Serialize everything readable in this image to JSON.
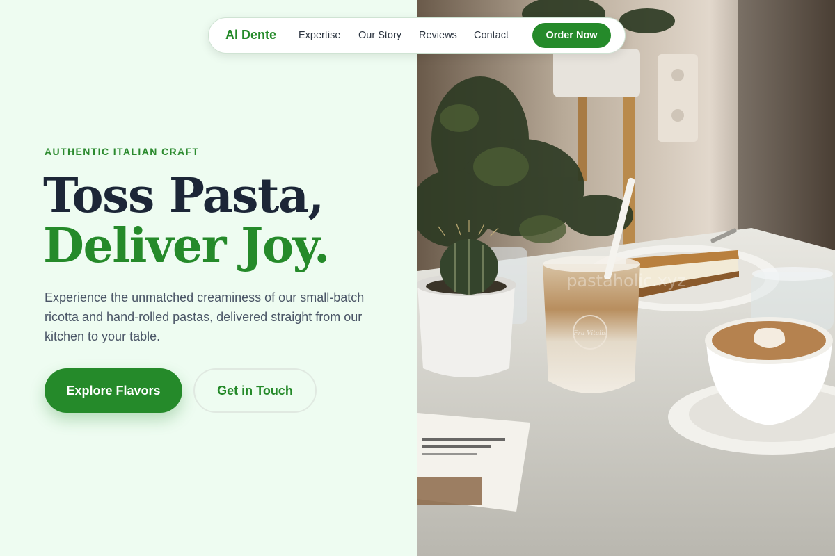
{
  "nav": {
    "brand": "Al Dente",
    "links": [
      "Expertise",
      "Our Story",
      "Reviews",
      "Contact"
    ],
    "cta": "Order Now"
  },
  "hero": {
    "eyebrow": "AUTHENTIC ITALIAN CRAFT",
    "headline_line1": "Toss Pasta,",
    "headline_line2": "Deliver Joy.",
    "lede": "Experience the unmatched creaminess of our small-batch ricotta and hand-rolled pastas, delivered straight from our kitchen to your table.",
    "primary_cta": "Explore Flavors",
    "secondary_cta": "Get in Touch"
  },
  "photo": {
    "subject": "cafe-table-photo",
    "watermark": "pastaholic.xyz",
    "cup_logo": "Fra Vitalis"
  },
  "colors": {
    "brand_green": "#258a2a",
    "headline_dark": "#1c2637",
    "background_mint": "#eefcf1",
    "body_text": "#4a5566"
  }
}
